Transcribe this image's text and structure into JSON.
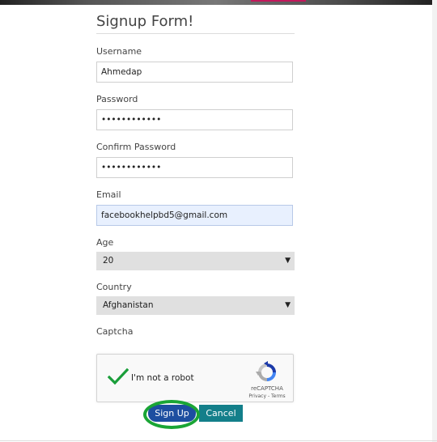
{
  "form": {
    "title": "Signup Form!",
    "username": {
      "label": "Username",
      "value": "Ahmedap"
    },
    "password": {
      "label": "Password",
      "value": "••••••••••••"
    },
    "confirm_password": {
      "label": "Confirm Password",
      "value": "••••••••••••"
    },
    "email": {
      "label": "Email",
      "value": "facebookhelpbd5@gmail.com"
    },
    "age": {
      "label": "Age",
      "value": "20"
    },
    "country": {
      "label": "Country",
      "value": "Afghanistan"
    },
    "captcha": {
      "label": "Captcha",
      "checkbox_text": "I'm not a robot",
      "brand": "reCAPTCHA",
      "links": "Privacy - Terms",
      "checked": true
    },
    "buttons": {
      "signup": "Sign Up",
      "cancel": "Cancel"
    }
  },
  "colors": {
    "signup_button": "#1d4ea0",
    "cancel_button": "#137f8a",
    "highlight_ring": "#1aa535",
    "check_mark": "#1a9e3a"
  },
  "icons": {
    "check": "checkmark-icon",
    "recaptcha": "recaptcha-logo-icon",
    "dropdown": "dropdown-caret-icon"
  }
}
